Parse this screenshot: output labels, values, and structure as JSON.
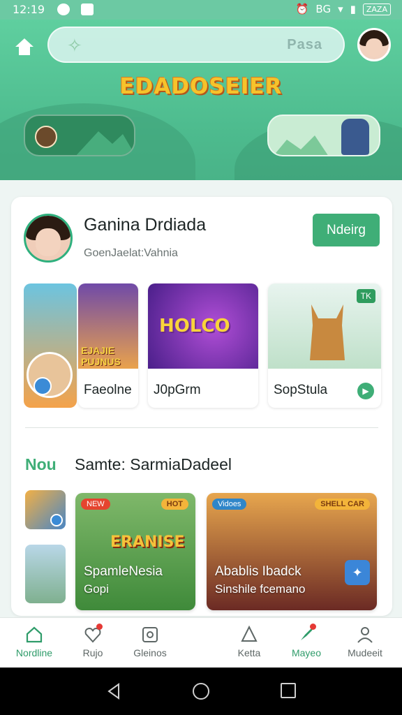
{
  "status_bar": {
    "time": "12:19",
    "right_text": "BG",
    "battery": "ZAZA"
  },
  "header": {
    "title": "EDADOSEIER",
    "search_text": "Pasa",
    "search_glyph": "✧"
  },
  "profile": {
    "name": "Ganina Drdiada",
    "subtitle": "GoenJaelat:Vahnia",
    "follow_label": "Ndeirg"
  },
  "featured_tiles": [
    {
      "label": "Faeolne",
      "art_text": "EJAJIE PUJNUS"
    },
    {
      "label": "J0pGrm",
      "art_text": "HOLCO"
    },
    {
      "label": "SopStula",
      "tag": "TK"
    }
  ],
  "section": {
    "tag": "Nou",
    "title": "Samte: SarmiaDadeel"
  },
  "games": [
    {
      "chip": "NEW",
      "chip2": "HOT",
      "big_word": "ERANISE",
      "name": "SpamleNesia",
      "sub": "Gopi"
    },
    {
      "chip": "Vidoes",
      "chip2": "SHELL CAR",
      "name": "Abablis Ibadck",
      "sub": "Sinshile fcemano"
    }
  ],
  "bottom_nav": [
    {
      "label": "Nordline",
      "icon": "home-icon",
      "active": true
    },
    {
      "label": "Rujo",
      "icon": "heart-icon",
      "active": false,
      "notif": true
    },
    {
      "label": "Gleinos",
      "icon": "gallery-icon",
      "active": false
    },
    {
      "label": "Ketta",
      "icon": "bell-icon",
      "active": false
    },
    {
      "label": "Mayeo",
      "icon": "rocket-icon",
      "active": true,
      "notif": true
    },
    {
      "label": "Mudeeit",
      "icon": "user-icon",
      "active": false
    }
  ],
  "colors": {
    "accent": "#3fae77",
    "hero": "#5fcf9f",
    "title": "#f6c32b"
  }
}
